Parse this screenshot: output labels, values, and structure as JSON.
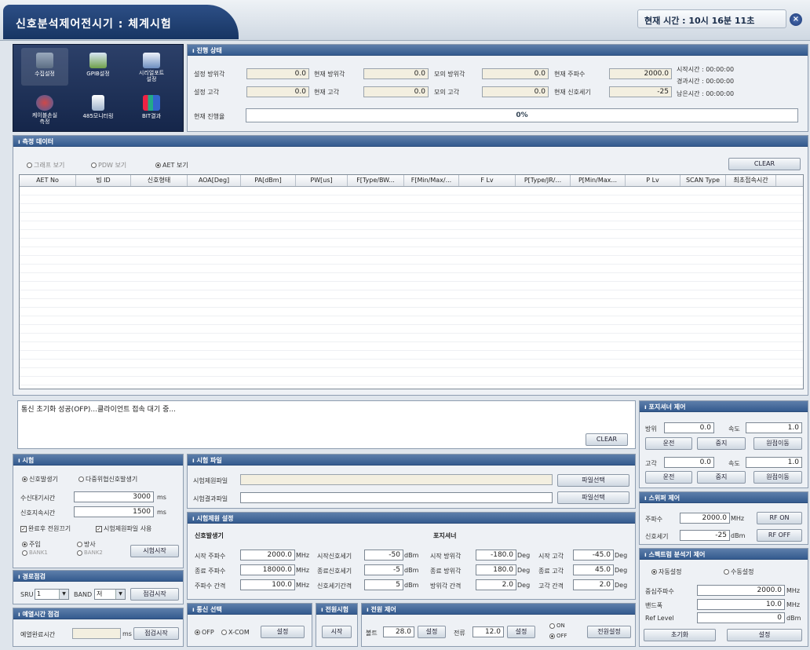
{
  "title": "신호분석제어전시기 : 체계시험",
  "clock": "현재 시간 : 10시 16분 11초",
  "icons": [
    {
      "label": "수집설정",
      "icon": "monitor-icon"
    },
    {
      "label": "GPIB설정",
      "icon": "tools-icon"
    },
    {
      "label": "시리얼포트\n설정",
      "icon": "grid-check-icon"
    },
    {
      "label": "케이블손실\n측정",
      "icon": "cable-icon"
    },
    {
      "label": "485모니터링",
      "icon": "document-icon"
    },
    {
      "label": "BIT결과",
      "icon": "chart-icon"
    }
  ],
  "progress": {
    "header": "진행 상태",
    "set_az_label": "설정 방위각",
    "set_az": "0.0",
    "cur_az_label": "현재 방위각",
    "cur_az": "0.0",
    "sim_az_label": "모의 방위각",
    "sim_az": "0.0",
    "cur_freq_label": "현재 주파수",
    "cur_freq": "2000.0",
    "set_el_label": "설정 고각",
    "set_el": "0.0",
    "cur_el_label": "현재 고각",
    "cur_el": "0.0",
    "sim_el_label": "모의 고각",
    "sim_el": "0.0",
    "cur_sig_label": "현재 신호세기",
    "cur_sig": "-25",
    "start_time": "시작시간 : 00:00:00",
    "elapsed_time": "경과시간 : 00:00:00",
    "remain_time": "남은시간 : 00:00:00",
    "rate_label": "현재 진행율",
    "rate": "0%"
  },
  "measure": {
    "header": "측정 데이터",
    "view_graph": "그래프 보기",
    "view_pdw": "PDW 보기",
    "view_aet": "AET 보기",
    "clear": "CLEAR",
    "columns": [
      "AET No",
      "빔 ID",
      "신호형태",
      "AOA[Deg]",
      "PA[dBm]",
      "PW[us]",
      "F[Type/BW...",
      "F[Min/Max/...",
      "F Lv",
      "P[Type/JR/...",
      "P[Min/Max...",
      "P Lv",
      "SCAN Type",
      "최초접속시간"
    ]
  },
  "log": {
    "text": "통신 초기화 성공(OFP)...클라이언트 접속 대기 중...",
    "clear": "CLEAR"
  },
  "positioner": {
    "header": "포지셔너 제어",
    "az_label": "방위",
    "az": "0.0",
    "speed_label": "속도",
    "az_speed": "1.0",
    "run": "운전",
    "stop": "중지",
    "home": "원점이동",
    "el_label": "고각",
    "el": "0.0",
    "el_speed": "1.0"
  },
  "switch": {
    "header": "스위퍼 제어",
    "freq_label": "주파수",
    "freq": "2000.0",
    "freq_unit": "MHz",
    "power_label": "신호세기",
    "power": "-25",
    "power_unit": "dBm",
    "rf_on": "RF ON",
    "rf_off": "RF OFF"
  },
  "spectrum": {
    "header": "스펙트럼 분석기 제어",
    "auto": "자동설정",
    "manual": "수동설정",
    "center_label": "중심주파수",
    "center": "2000.0",
    "center_unit": "MHz",
    "bw_label": "밴드폭",
    "bw": "10.0",
    "bw_unit": "MHz",
    "ref_label": "Ref Level",
    "ref": "0",
    "ref_unit": "dBm",
    "init": "초기화",
    "set": "설정"
  },
  "test": {
    "header": "시험",
    "sig_gen": "신호발생기",
    "multi_gen": "다중위협신호발생기",
    "wait_label": "수신대기시간",
    "wait": "3000",
    "wait_unit": "ms",
    "dur_label": "신호지속시간",
    "dur": "1500",
    "dur_unit": "ms",
    "power_off": "완료후 전원끄기",
    "use_file": "시험제원파일 사용",
    "recv": "주입",
    "emit": "방사",
    "bank1": "BANK1",
    "bank2": "BANK2",
    "start": "시험시작"
  },
  "route": {
    "header": "경로점검",
    "sru_label": "SRU",
    "sru": "1",
    "band_label": "BAND",
    "band": "저",
    "start": "점검시작"
  },
  "preheat": {
    "header": "예열시간 점검",
    "label": "예열완료시간",
    "unit": "ms",
    "start": "점검시작"
  },
  "testfile": {
    "header": "시험 파일",
    "spec_label": "시험제원파일",
    "result_label": "시험결과파일",
    "select": "파일선택"
  },
  "spec": {
    "header": "시험제원 설정",
    "sig_section": "신호발생기",
    "pos_section": "포지셔너",
    "start_freq_label": "시작 주파수",
    "start_freq": "2000.0",
    "end_freq_label": "종료 주파수",
    "end_freq": "18000.0",
    "step_freq_label": "주파수 간격",
    "step_freq": "100.0",
    "freq_unit": "MHz",
    "start_pow_label": "시작신호세기",
    "start_pow": "-50",
    "end_pow_label": "종료신호세기",
    "end_pow": "-5",
    "step_pow_label": "신호세기간격",
    "step_pow": "5",
    "pow_unit": "dBm",
    "start_az_label": "시작 방위각",
    "start_az": "-180.0",
    "end_az_label": "종료 방위각",
    "end_az": "180.0",
    "step_az_label": "방위각 간격",
    "step_az": "2.0",
    "deg_unit": "Deg",
    "start_el_label": "시작 고각",
    "start_el": "-45.0",
    "end_el_label": "종료 고각",
    "end_el": "45.0",
    "step_el_label": "고각 간격",
    "step_el": "2.0"
  },
  "comm": {
    "header": "통신 선택",
    "ofp": "OFP",
    "xcom": "X-COM",
    "set": "설정"
  },
  "powertest": {
    "header": "전원시험",
    "start": "시작"
  },
  "powerctl": {
    "header": "전원 제어",
    "volt_label": "볼트",
    "volt": "28.0",
    "cur_label": "전류",
    "cur": "12.0",
    "set": "설정",
    "on": "ON",
    "off": "OFF",
    "power_set": "전원설정"
  }
}
